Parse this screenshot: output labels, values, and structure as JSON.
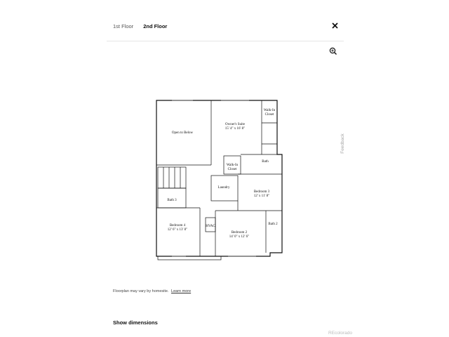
{
  "tabs": [
    {
      "label": "1st Floor",
      "active": false
    },
    {
      "label": "2nd Floor",
      "active": true
    }
  ],
  "close_icon": "close-icon",
  "zoom_icon": "zoom-in-icon",
  "feedback_label": "Feedback",
  "floorplan": {
    "rooms": {
      "open_to_below": "Open to Below",
      "owners_suite": "Owner's Suite",
      "owners_suite_dim": "15' 4\" x 16' 8\"",
      "walk_in_closet_1": "Walk-In",
      "walk_in_closet_1b": "Closet",
      "bath_main": "Bath",
      "walk_in_closet_2": "Walk-In",
      "walk_in_closet_2b": "Closet",
      "laundry": "Laundry",
      "bedroom3": "Bedroom 3",
      "bedroom3_dim": "12' x 11' 8\"",
      "bath3": "Bath 3",
      "bedroom4": "Bedroom 4",
      "bedroom4_dim": "12' 6\" x 13' 8\"",
      "hvac": "HVAC",
      "bedroom2": "Bedroom 2",
      "bedroom2_dim": "14' 0\" x 12' 6\"",
      "bath2": "Bath 2"
    }
  },
  "disclaimer": "Floorplan may vary by homesite.",
  "learn_more": "Learn more",
  "show_dimensions": "Show dimensions",
  "brand": "REcolorado"
}
